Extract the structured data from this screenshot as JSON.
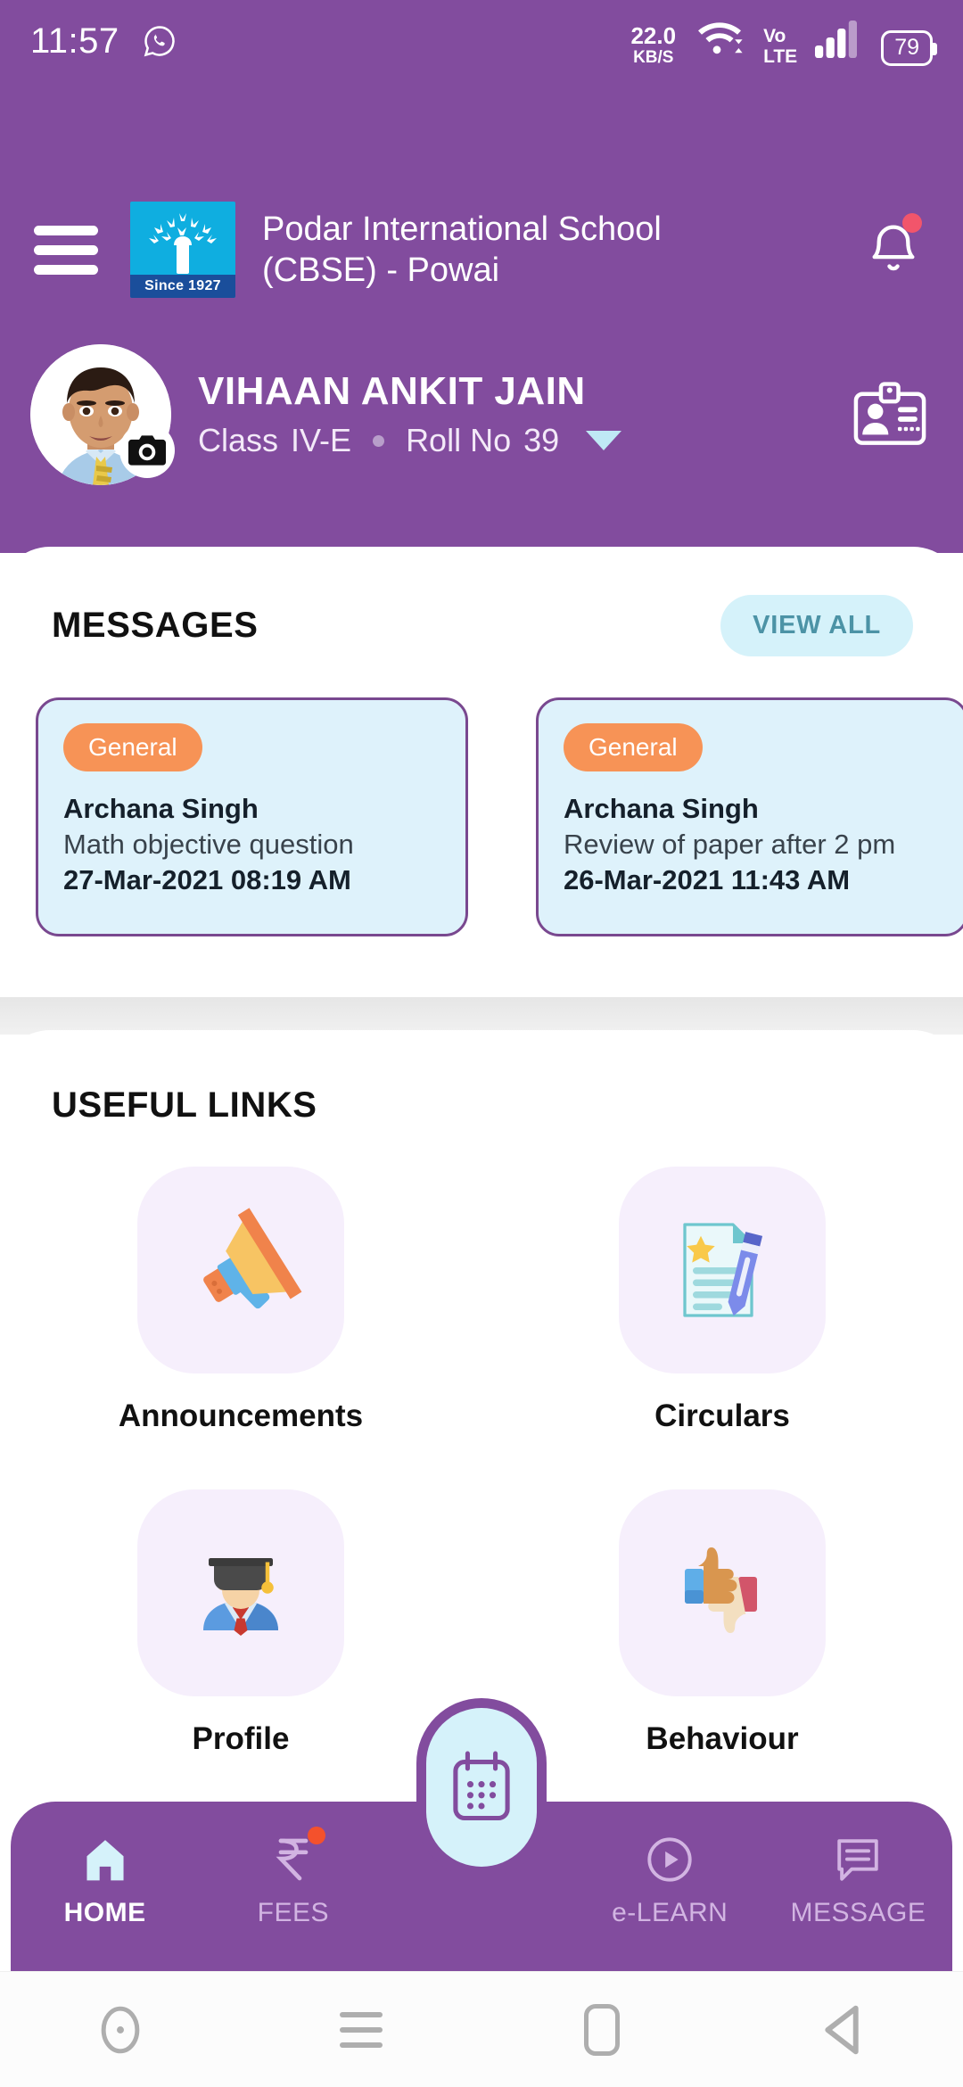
{
  "statusbar": {
    "time": "11:57",
    "whatsapp_icon": "whatsapp-icon",
    "network_speed_value": "22.0",
    "network_speed_unit": "KB/S",
    "wifi_icon": "wifi-icon",
    "volte_line1": "Vo",
    "volte_line2": "LTE",
    "signal_icon": "cellular-signal-icon",
    "battery_percent": "79"
  },
  "appbar": {
    "menu_icon": "hamburger-menu-icon",
    "logo_since": "Since 1927",
    "school_name": "Podar International School (CBSE) - Powai",
    "notification_icon": "bell-icon",
    "notification_badge": true
  },
  "student": {
    "avatar_icon": "student-photo",
    "camera_icon": "camera-icon",
    "name": "VIHAAN ANKIT JAIN",
    "class_label": "Class",
    "class_value": "IV-E",
    "roll_label": "Roll No",
    "roll_value": "39",
    "dropdown_icon": "chevron-down-icon",
    "idcard_icon": "id-card-icon"
  },
  "messages": {
    "title": "MESSAGES",
    "view_all_label": "VIEW ALL",
    "items": [
      {
        "tag": "General",
        "from": "Archana Singh",
        "subject": "Math objective question",
        "datetime": "27-Mar-2021 08:19 AM"
      },
      {
        "tag": "General",
        "from": "Archana Singh",
        "subject": "Review of paper after 2 pm",
        "datetime": "26-Mar-2021 11:43 AM"
      }
    ]
  },
  "useful_links": {
    "title": "USEFUL LINKS",
    "items": [
      {
        "label": "Announcements",
        "icon": "megaphone-icon"
      },
      {
        "label": "Circulars",
        "icon": "document-pen-icon"
      },
      {
        "label": "Profile",
        "icon": "graduate-student-icon"
      },
      {
        "label": "Behaviour",
        "icon": "thumbs-up-down-icon"
      }
    ]
  },
  "bottom_nav": {
    "items": [
      {
        "label": "HOME",
        "icon": "home-icon",
        "active": true,
        "badge": false
      },
      {
        "label": "FEES",
        "icon": "rupee-icon",
        "active": false,
        "badge": true
      },
      {
        "label": "e-LEARN",
        "icon": "play-circle-icon",
        "active": false,
        "badge": false
      },
      {
        "label": "MESSAGE",
        "icon": "chat-bubble-icon",
        "active": false,
        "badge": false
      }
    ],
    "fab_icon": "calendar-icon"
  },
  "android_nav": {
    "buttons": [
      {
        "icon": "circle-dot-icon"
      },
      {
        "icon": "recents-hamburger-icon"
      },
      {
        "icon": "home-square-icon"
      },
      {
        "icon": "back-triangle-icon"
      }
    ]
  },
  "colors": {
    "brand_purple": "#824C9E",
    "card_blue": "#DEF2FB",
    "tag_orange": "#F79356",
    "accent_cyan": "#D5F2FA",
    "tile_lavender": "#F6EFFC",
    "badge_red": "#F4512C"
  }
}
